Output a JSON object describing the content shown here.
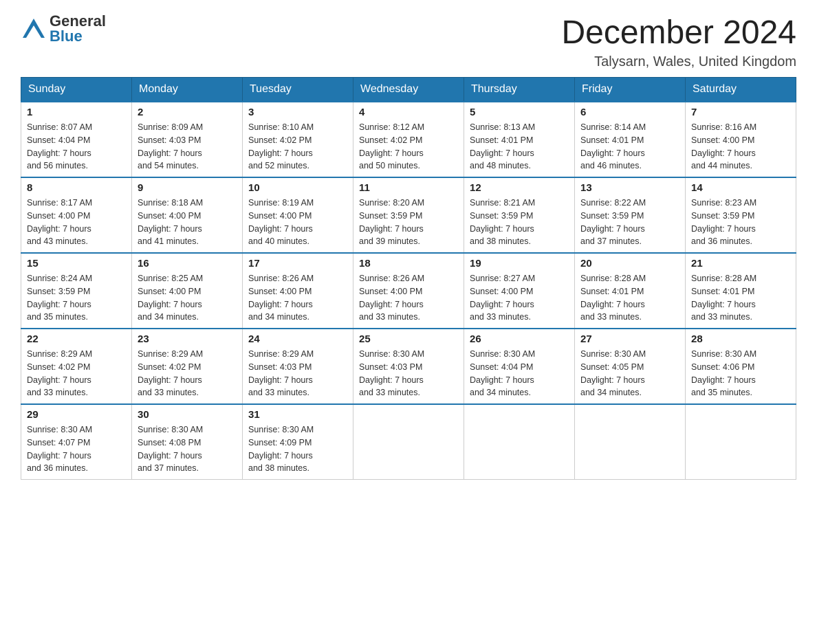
{
  "header": {
    "logo_general": "General",
    "logo_blue": "Blue",
    "title": "December 2024",
    "location": "Talysarn, Wales, United Kingdom"
  },
  "days_of_week": [
    "Sunday",
    "Monday",
    "Tuesday",
    "Wednesday",
    "Thursday",
    "Friday",
    "Saturday"
  ],
  "weeks": [
    [
      {
        "num": "1",
        "sunrise": "8:07 AM",
        "sunset": "4:04 PM",
        "daylight": "7 hours and 56 minutes."
      },
      {
        "num": "2",
        "sunrise": "8:09 AM",
        "sunset": "4:03 PM",
        "daylight": "7 hours and 54 minutes."
      },
      {
        "num": "3",
        "sunrise": "8:10 AM",
        "sunset": "4:02 PM",
        "daylight": "7 hours and 52 minutes."
      },
      {
        "num": "4",
        "sunrise": "8:12 AM",
        "sunset": "4:02 PM",
        "daylight": "7 hours and 50 minutes."
      },
      {
        "num": "5",
        "sunrise": "8:13 AM",
        "sunset": "4:01 PM",
        "daylight": "7 hours and 48 minutes."
      },
      {
        "num": "6",
        "sunrise": "8:14 AM",
        "sunset": "4:01 PM",
        "daylight": "7 hours and 46 minutes."
      },
      {
        "num": "7",
        "sunrise": "8:16 AM",
        "sunset": "4:00 PM",
        "daylight": "7 hours and 44 minutes."
      }
    ],
    [
      {
        "num": "8",
        "sunrise": "8:17 AM",
        "sunset": "4:00 PM",
        "daylight": "7 hours and 43 minutes."
      },
      {
        "num": "9",
        "sunrise": "8:18 AM",
        "sunset": "4:00 PM",
        "daylight": "7 hours and 41 minutes."
      },
      {
        "num": "10",
        "sunrise": "8:19 AM",
        "sunset": "4:00 PM",
        "daylight": "7 hours and 40 minutes."
      },
      {
        "num": "11",
        "sunrise": "8:20 AM",
        "sunset": "3:59 PM",
        "daylight": "7 hours and 39 minutes."
      },
      {
        "num": "12",
        "sunrise": "8:21 AM",
        "sunset": "3:59 PM",
        "daylight": "7 hours and 38 minutes."
      },
      {
        "num": "13",
        "sunrise": "8:22 AM",
        "sunset": "3:59 PM",
        "daylight": "7 hours and 37 minutes."
      },
      {
        "num": "14",
        "sunrise": "8:23 AM",
        "sunset": "3:59 PM",
        "daylight": "7 hours and 36 minutes."
      }
    ],
    [
      {
        "num": "15",
        "sunrise": "8:24 AM",
        "sunset": "3:59 PM",
        "daylight": "7 hours and 35 minutes."
      },
      {
        "num": "16",
        "sunrise": "8:25 AM",
        "sunset": "4:00 PM",
        "daylight": "7 hours and 34 minutes."
      },
      {
        "num": "17",
        "sunrise": "8:26 AM",
        "sunset": "4:00 PM",
        "daylight": "7 hours and 34 minutes."
      },
      {
        "num": "18",
        "sunrise": "8:26 AM",
        "sunset": "4:00 PM",
        "daylight": "7 hours and 33 minutes."
      },
      {
        "num": "19",
        "sunrise": "8:27 AM",
        "sunset": "4:00 PM",
        "daylight": "7 hours and 33 minutes."
      },
      {
        "num": "20",
        "sunrise": "8:28 AM",
        "sunset": "4:01 PM",
        "daylight": "7 hours and 33 minutes."
      },
      {
        "num": "21",
        "sunrise": "8:28 AM",
        "sunset": "4:01 PM",
        "daylight": "7 hours and 33 minutes."
      }
    ],
    [
      {
        "num": "22",
        "sunrise": "8:29 AM",
        "sunset": "4:02 PM",
        "daylight": "7 hours and 33 minutes."
      },
      {
        "num": "23",
        "sunrise": "8:29 AM",
        "sunset": "4:02 PM",
        "daylight": "7 hours and 33 minutes."
      },
      {
        "num": "24",
        "sunrise": "8:29 AM",
        "sunset": "4:03 PM",
        "daylight": "7 hours and 33 minutes."
      },
      {
        "num": "25",
        "sunrise": "8:30 AM",
        "sunset": "4:03 PM",
        "daylight": "7 hours and 33 minutes."
      },
      {
        "num": "26",
        "sunrise": "8:30 AM",
        "sunset": "4:04 PM",
        "daylight": "7 hours and 34 minutes."
      },
      {
        "num": "27",
        "sunrise": "8:30 AM",
        "sunset": "4:05 PM",
        "daylight": "7 hours and 34 minutes."
      },
      {
        "num": "28",
        "sunrise": "8:30 AM",
        "sunset": "4:06 PM",
        "daylight": "7 hours and 35 minutes."
      }
    ],
    [
      {
        "num": "29",
        "sunrise": "8:30 AM",
        "sunset": "4:07 PM",
        "daylight": "7 hours and 36 minutes."
      },
      {
        "num": "30",
        "sunrise": "8:30 AM",
        "sunset": "4:08 PM",
        "daylight": "7 hours and 37 minutes."
      },
      {
        "num": "31",
        "sunrise": "8:30 AM",
        "sunset": "4:09 PM",
        "daylight": "7 hours and 38 minutes."
      },
      null,
      null,
      null,
      null
    ]
  ],
  "labels": {
    "sunrise": "Sunrise:",
    "sunset": "Sunset:",
    "daylight": "Daylight:"
  }
}
